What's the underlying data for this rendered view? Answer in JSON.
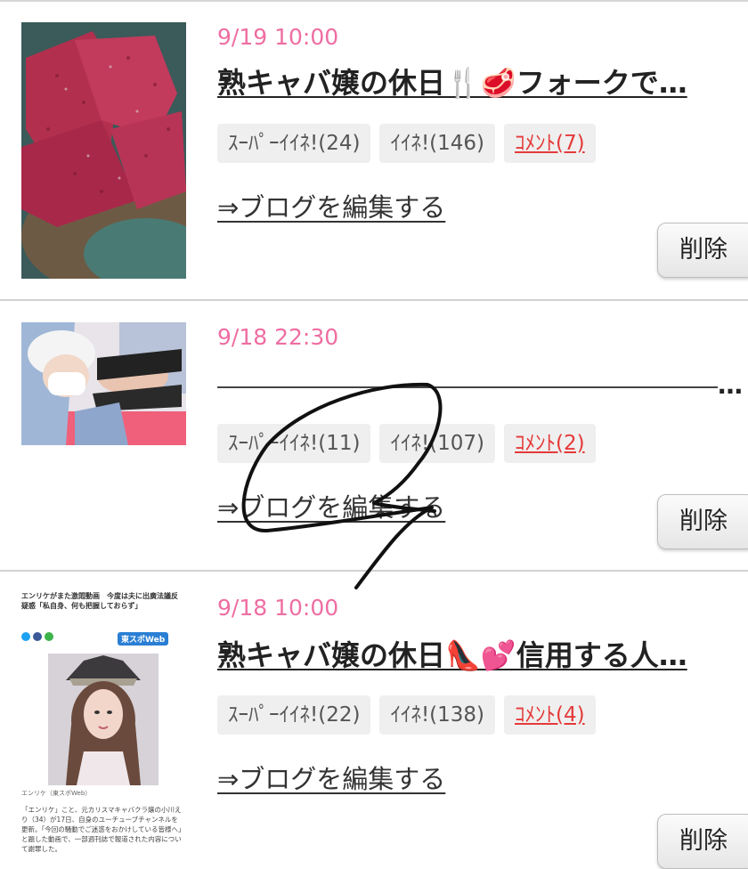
{
  "posts": [
    {
      "date": "9/19 10:00",
      "title": "熟キャバ嬢の休日🍴🥩フォークで…",
      "super_like": "ｽｰﾊﾟｰｲｲﾈ!(24)",
      "like": "ｲｲﾈ!(146)",
      "comment": "ｺﾒﾝﾄ(7)",
      "edit_link": "⇒ブログを編集する",
      "delete_label": "削除",
      "thumb_desc": "steak"
    },
    {
      "date": "9/18 22:30",
      "title": "",
      "super_like": "ｽｰﾊﾟｰｲｲﾈ!(11)",
      "like": "ｲｲﾈ!(107)",
      "comment": "ｺﾒﾝﾄ(2)",
      "edit_link": "⇒ブログを編集する",
      "delete_label": "削除",
      "thumb_desc": "selfie"
    },
    {
      "date": "9/18 10:00",
      "title": "熟キャバ嬢の休日👠💕信用する人…",
      "super_like": "ｽｰﾊﾟｰｲｲﾈ!(22)",
      "like": "ｲｲﾈ!(138)",
      "comment": "ｺﾒﾝﾄ(4)",
      "edit_link": "⇒ブログを編集する",
      "delete_label": "削除",
      "thumb_desc": "news-article"
    }
  ],
  "news_thumb": {
    "headline": "エンリケがまた激悶動画　今度は夫に出廣法議反疑惑「私自身、何も把握しておらず」",
    "source": "東スポWeb",
    "caption": "エンリケ（東スポWeb）",
    "body": "「エンリケ」こと、元カリスマキャバクラ嬢の小川えり（34）が17日、自身のユーチューブチャンネルを更新。「今回の騒動でご迷惑をおかけしている皆様へ」と題した動画で、一部週刊誌で報道された内容について謝罪した。"
  },
  "colors": {
    "date": "#ee6ea2",
    "comment": "#e53a3a",
    "chip_bg": "#efefef"
  }
}
